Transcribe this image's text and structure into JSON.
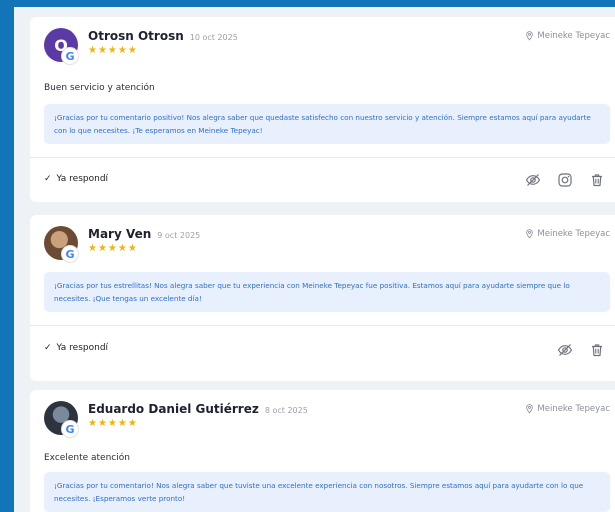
{
  "reviews": [
    {
      "name": "Otrosn Otrosn",
      "date": "10 oct 2025",
      "avatar_letter": "O",
      "stars": "★★★★★",
      "location": "Meineke Tepeyac",
      "comment": "Buen servicio y atención",
      "reply": "¡Gracias por tu comentario positivo! Nos alegra saber que quedaste satisfecho con nuestro servicio y atención. Siempre estamos aquí para ayudarte con lo que necesites. ¡Te esperamos en Meineke Tepeyac!",
      "status": "Ya respondí"
    },
    {
      "name": "Mary Ven",
      "date": "9 oct 2025",
      "stars": "★★★★★",
      "location": "Meineke Tepeyac",
      "comment": "",
      "reply": "¡Gracias por tus estrellitas! Nos alegra saber que tu experiencia con Meineke Tepeyac fue positiva. Estamos aquí para ayudarte siempre que lo necesites. ¡Que tengas un excelente día!",
      "status": "Ya respondí"
    },
    {
      "name": "Eduardo Daniel Gutiérrez",
      "date": "8 oct 2025",
      "stars": "★★★★★",
      "location": "Meineke Tepeyac",
      "comment": "Excelente atención",
      "reply": "¡Gracias por tu comentario! Nos alegra saber que tuviste una excelente experiencia con nosotros. Siempre estamos aquí para ayudarte con lo que necesites. ¡Esperamos verte pronto!"
    }
  ],
  "google_badge": "G",
  "check_mark": "✓",
  "colors": {
    "background": "#1275b7",
    "star": "#f5b400",
    "reply_bg": "#e8f0fd",
    "reply_text": "#2f6fd1"
  },
  "icons": [
    "location-pin-icon",
    "hide-icon",
    "instagram-icon",
    "trash-icon"
  ]
}
